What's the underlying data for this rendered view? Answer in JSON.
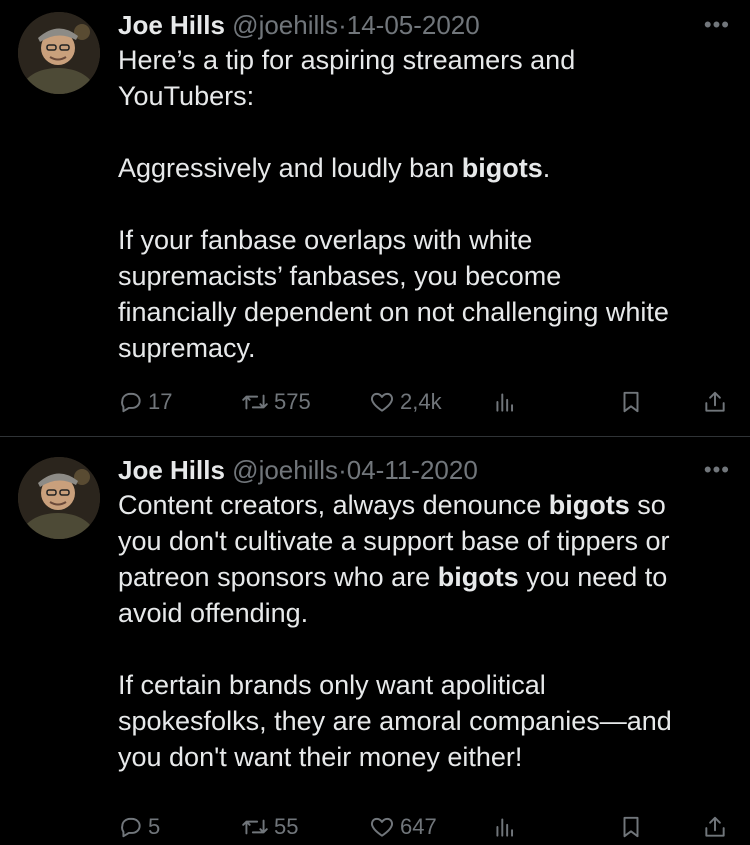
{
  "tweets": [
    {
      "name": "Joe Hills",
      "handle": "@joehills",
      "dot": "·",
      "date": "14-05-2020",
      "more": "•••",
      "paragraphs": [
        [
          "Here’s a tip for aspiring streamers and",
          "YouTubers:"
        ],
        [
          "Aggressively and loudly ban |bigots|."
        ],
        [
          "If your fanbase overlaps with white",
          "supremacists’ fanbases, you become",
          "financially dependent on not challenging white",
          "supremacy."
        ]
      ],
      "replies": "17",
      "retweets": "575",
      "likes": "2,4k"
    },
    {
      "name": "Joe Hills",
      "handle": "@joehills",
      "dot": "·",
      "date": "04-11-2020",
      "more": "•••",
      "paragraphs": [
        [
          "Content creators, always denounce |bigots| so",
          "you don't cultivate a support base of tippers or",
          "patreon sponsors who are |bigots| you need to",
          "avoid offending."
        ],
        [
          "If certain brands only want apolitical",
          "spokesfolks, they are amoral companies—and",
          "you don't want their money either!"
        ]
      ],
      "replies": "5",
      "retweets": "55",
      "likes": "647"
    }
  ],
  "colors": {
    "background": "#000000",
    "text": "#e7e9ea",
    "muted": "#71767b",
    "divider": "#2f3336"
  },
  "icons": [
    "reply-icon",
    "retweet-icon",
    "like-icon",
    "views-icon",
    "bookmark-icon",
    "share-icon",
    "more-icon"
  ]
}
